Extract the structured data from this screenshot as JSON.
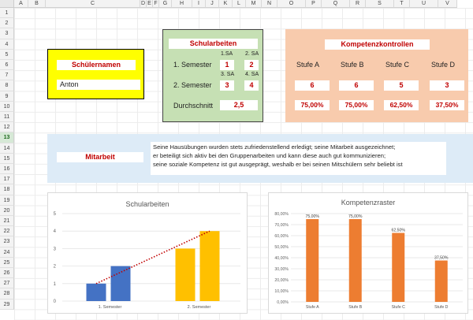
{
  "columns": [
    "A",
    "B",
    "C",
    "D",
    "E",
    "F",
    "G",
    "H",
    "I",
    "J",
    "K",
    "L",
    "M",
    "N",
    "O",
    "P",
    "Q",
    "R",
    "S",
    "T",
    "U",
    "V"
  ],
  "rows": [
    "1",
    "2",
    "3",
    "4",
    "5",
    "6",
    "7",
    "8",
    "9",
    "10",
    "11",
    "12",
    "13",
    "14",
    "15",
    "16",
    "17",
    "18",
    "19",
    "20",
    "21",
    "22",
    "23",
    "24",
    "25",
    "26",
    "27",
    "28",
    "29"
  ],
  "selected_row": "13",
  "schueler": {
    "title": "Schülernamen",
    "name": "Anton"
  },
  "schularbeiten": {
    "title": "Schularbeiten",
    "sa1_label": "1.SA",
    "sa2_label": "2. SA",
    "sa3_label": "3. SA",
    "sa4_label": "4. SA",
    "sem1_label": "1. Semester",
    "sem2_label": "2. Semester",
    "sa1": "1",
    "sa2": "2",
    "sa3": "3",
    "sa4": "4",
    "avg_label": "Durchschnitt",
    "avg": "2,5"
  },
  "kompetenz": {
    "title": "Kompetenzkontrollen",
    "levels": [
      "Stufe A",
      "Stufe B",
      "Stufe C",
      "Stufe D"
    ],
    "values": [
      "6",
      "6",
      "5",
      "3"
    ],
    "percents": [
      "75,00%",
      "75,00%",
      "62,50%",
      "37,50%"
    ]
  },
  "mitarbeit": {
    "title": "Mitarbeit",
    "lines": [
      "Seine Hausübungen wurden stets zufriedenstellend erledigt; seine Mitarbeit ausgezeichnet;",
      "er beteiligt sich aktiv bei den Gruppenarbeiten und kann  diese auch gut kommunizieren;",
      "seine soziale Kompetenz ist gut ausgeprägt, weshalb er bei seinen Mitschülern sehr beliebt ist"
    ]
  },
  "colors": {
    "green_box": "#c6e0b4",
    "yellow_box": "#ffff00",
    "peach_box": "#f8cbad",
    "blue_band": "#ddebf7",
    "bar_blue": "#4472c4",
    "bar_yellow": "#ffc000",
    "bar_orange": "#ed7d31",
    "accent_red": "#c00000"
  },
  "chart_data": [
    {
      "type": "bar",
      "title": "Schularbeiten",
      "categories": [
        "1. Semester",
        "2. Semester"
      ],
      "series": [
        {
          "values": [
            1,
            3
          ]
        },
        {
          "values": [
            2,
            4
          ]
        }
      ],
      "trendline": {
        "style": "dotted",
        "color": "#c00000"
      },
      "ylim": [
        0,
        5
      ],
      "yticks": [
        "0",
        "1",
        "2",
        "3",
        "4",
        "5"
      ],
      "grid": true
    },
    {
      "type": "bar",
      "title": "Kompetenzraster",
      "categories": [
        "Stufe A",
        "Stufe B",
        "Stufe C",
        "Stufe D"
      ],
      "values": [
        75,
        75,
        62.5,
        37.5
      ],
      "data_labels": [
        "75,00%",
        "75,00%",
        "62,50%",
        "37,50%"
      ],
      "ylim": [
        0,
        80
      ],
      "yticks": [
        "0,00%",
        "10,00%",
        "20,00%",
        "30,00%",
        "40,00%",
        "50,00%",
        "60,00%",
        "70,00%",
        "80,00%"
      ],
      "grid": true
    }
  ]
}
